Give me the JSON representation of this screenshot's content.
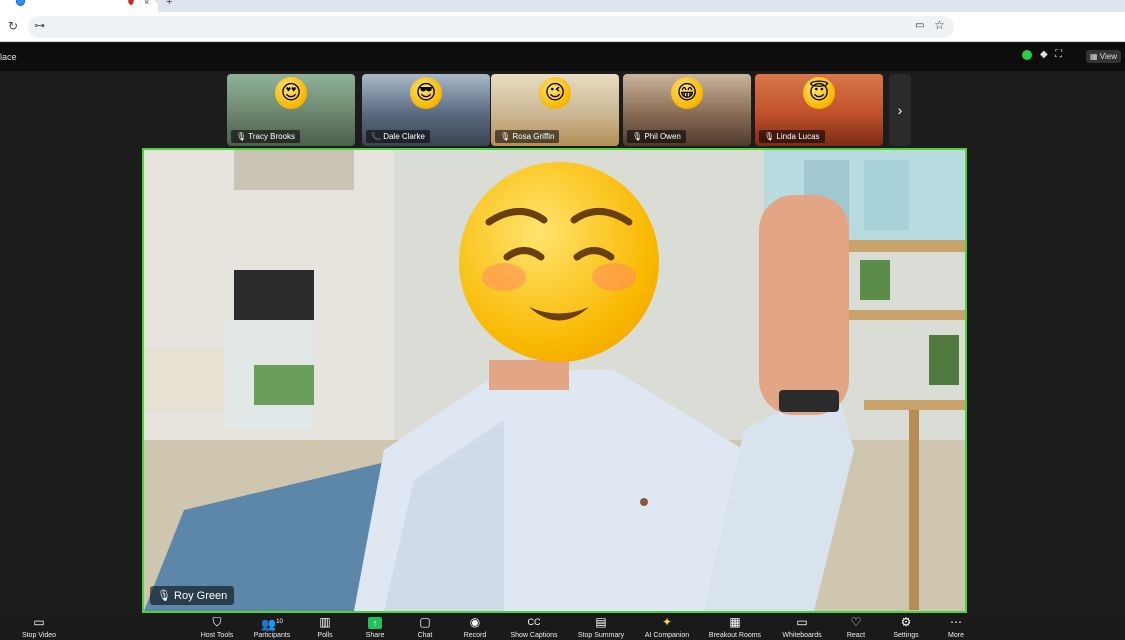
{
  "window": {
    "title": "lace"
  },
  "topbar": {
    "view_label": "View"
  },
  "gallery": [
    {
      "name": "Tracy Brooks",
      "emoji": "😍",
      "bg": "#6f8a70"
    },
    {
      "name": "Dale Clarke",
      "emoji": "😎",
      "bg": "#5b6a80"
    },
    {
      "name": "Rosa Griffin",
      "emoji": "😉",
      "bg": "#cbb894"
    },
    {
      "name": "Phil Owen",
      "emoji": "😁",
      "bg": "#8a6b56"
    },
    {
      "name": "Linda Lucas",
      "emoji": "😇",
      "bg": "#c0512b"
    }
  ],
  "speaker": {
    "name": "Roy Green",
    "emoji": "face-emoji"
  },
  "controls": [
    {
      "label": "Stop Video",
      "icon": "▭"
    },
    {
      "label": "Host Tools",
      "icon": "⛉"
    },
    {
      "label": "Participants",
      "icon": "👥",
      "count": "10"
    },
    {
      "label": "Polls",
      "icon": "▥"
    },
    {
      "label": "Share",
      "icon": "↑"
    },
    {
      "label": "Chat",
      "icon": "▢"
    },
    {
      "label": "Record",
      "icon": "◉"
    },
    {
      "label": "Show Captions",
      "icon": "CC"
    },
    {
      "label": "Stop Summary",
      "icon": "▤"
    },
    {
      "label": "AI Companion",
      "icon": "✦"
    },
    {
      "label": "Breakout Rooms",
      "icon": "▦"
    },
    {
      "label": "Whiteboards",
      "icon": "▭"
    },
    {
      "label": "React",
      "icon": "♡"
    },
    {
      "label": "Settings",
      "icon": "⚙"
    },
    {
      "label": "More",
      "icon": "⋯"
    }
  ],
  "colors": {
    "active_speaker_border": "#4fd13c",
    "share_green": "#23c159"
  }
}
